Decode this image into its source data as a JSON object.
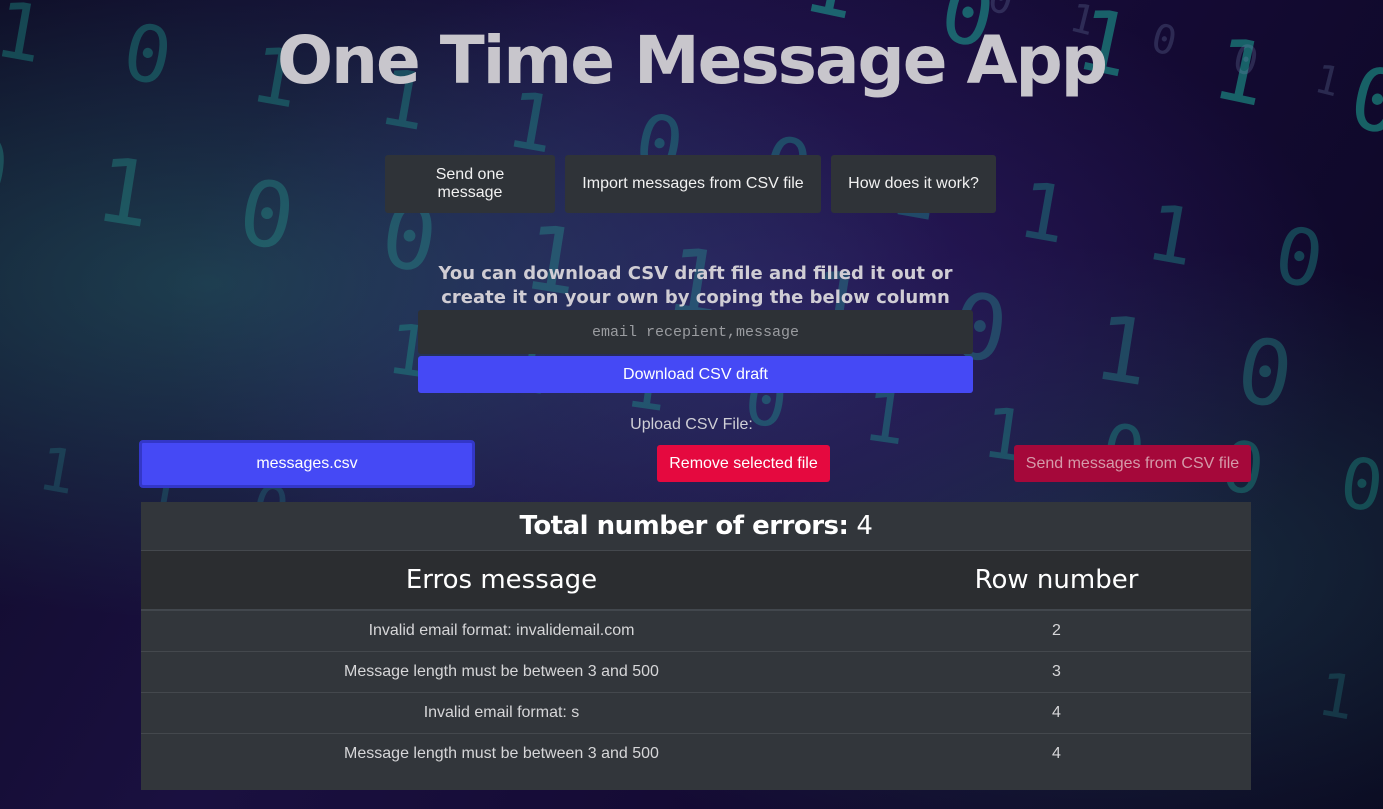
{
  "app": {
    "title": "One Time Message App"
  },
  "nav": {
    "items": [
      {
        "label": "Send one message"
      },
      {
        "label": "Import messages from CSV file"
      },
      {
        "label": "How does it work?"
      }
    ]
  },
  "csv_section": {
    "info_text": "You can download CSV draft file and filled it out or create it on your own by coping the below column names",
    "column_names": "email recepient,message",
    "download_label": "Download CSV draft",
    "upload_label": "Upload CSV File:",
    "selected_file": "messages.csv",
    "remove_label": "Remove selected file",
    "send_label": "Send messages from CSV file"
  },
  "errors": {
    "total_label": "Total number of errors:",
    "total_count": "4",
    "columns": {
      "message": "Erros message",
      "row": "Row number"
    },
    "rows": [
      {
        "message": "Invalid email format: invalidemail.com",
        "row": "2"
      },
      {
        "message": "Message length must be between 3 and 500",
        "row": "3"
      },
      {
        "message": "Invalid email format: s",
        "row": "4"
      },
      {
        "message": "Message length must be between 3 and 500",
        "row": "4"
      }
    ]
  },
  "colors": {
    "primary": "#4549f5",
    "danger": "#e5093f",
    "danger_muted": "#a5083a",
    "panel": "#32363b",
    "button_dark": "#2f3338"
  }
}
